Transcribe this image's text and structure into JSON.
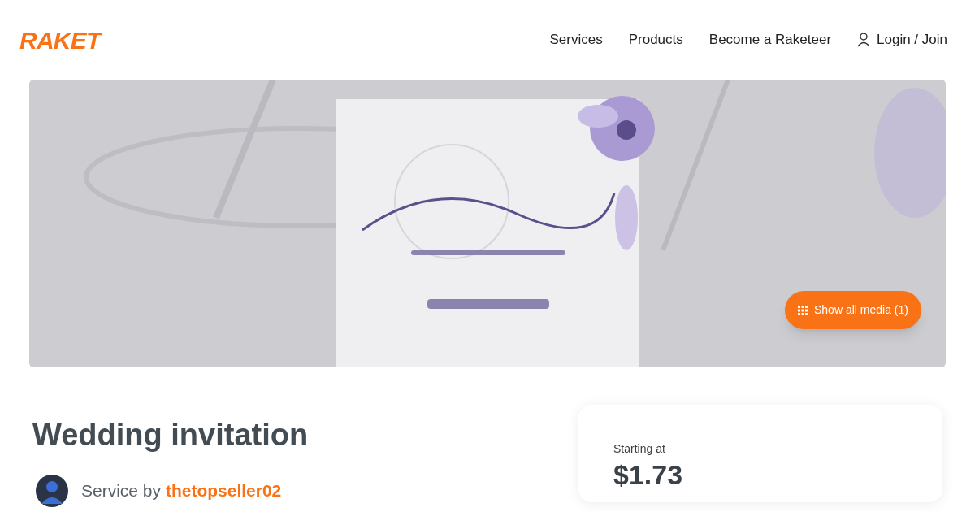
{
  "header": {
    "logo": "RAKET",
    "nav": [
      {
        "label": "Services",
        "kind": "link"
      },
      {
        "label": "Products",
        "kind": "link"
      },
      {
        "label": "Become a Raketeer",
        "kind": "link"
      },
      {
        "label": "Login / Join",
        "kind": "login"
      }
    ]
  },
  "media": {
    "button": "Show all media (1)"
  },
  "listing": {
    "title": "Wedding invitation",
    "service_by": "Service by",
    "seller": "thetopseller02"
  },
  "price_card": {
    "label": "Starting at",
    "price": "$1.73"
  }
}
